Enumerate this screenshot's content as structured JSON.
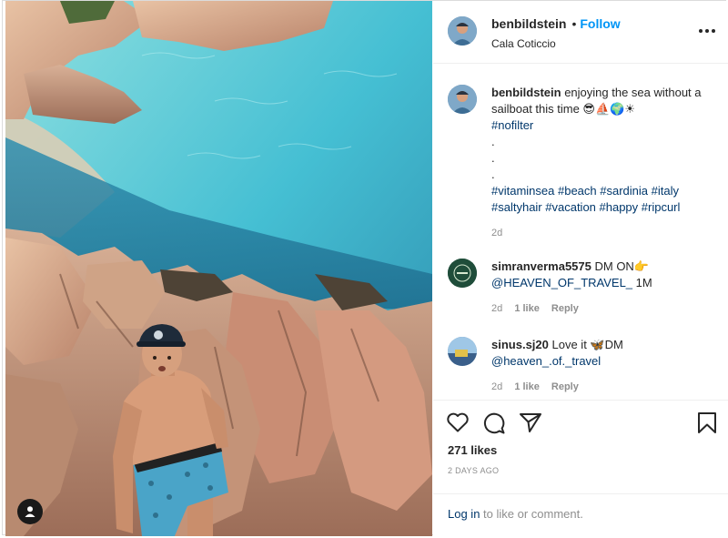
{
  "post": {
    "username": "benbildstein",
    "follow_label": "Follow",
    "separator": "•",
    "location": "Cala Coticcio"
  },
  "caption": {
    "username": "benbildstein",
    "text": "enjoying the sea without a sailboat this time 😎⛵🌍☀",
    "line1": "#nofilter",
    "dots": [
      ".",
      ".",
      "."
    ],
    "hashtags_line1": "#vitaminsea #beach #sardinia #italy",
    "hashtags_line2": "#saltyhair #vacation #happy #ripcurl",
    "time": "2d"
  },
  "comments": [
    {
      "username": "simranverma5575",
      "text": "DM ON👉",
      "mention": "@HEAVEN_OF_TRAVEL_",
      "suffix": "1M",
      "time": "2d",
      "likes": "1 like",
      "reply": "Reply",
      "avatar_color": "#1f4d3a"
    },
    {
      "username": "sinus.sj20",
      "text": "Love it 🦋DM",
      "mention": "@heaven_.of._travel",
      "suffix": "",
      "time": "2d",
      "likes": "1 like",
      "reply": "Reply",
      "avatar_color": "#3a5f8a"
    }
  ],
  "actions": {
    "icons": [
      "heart-icon",
      "comment-icon",
      "share-icon",
      "bookmark-icon"
    ],
    "likes": "271 likes",
    "date": "2 DAYS AGO"
  },
  "login": {
    "link": "Log in",
    "rest": "to like or comment."
  },
  "colors": {
    "link": "#00376b",
    "follow": "#0095f6",
    "muted": "#8e8e8e",
    "water": "#4fc3d6",
    "rock": "#d9a07e"
  }
}
